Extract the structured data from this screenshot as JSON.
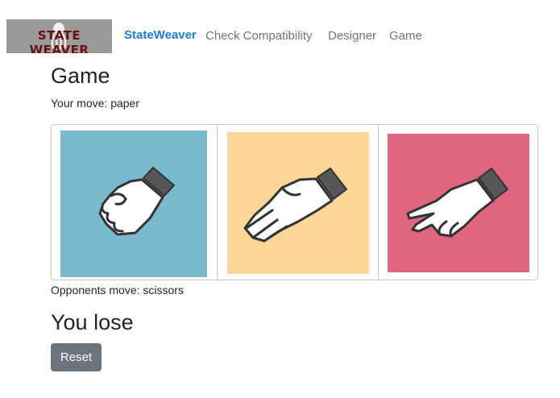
{
  "navbar": {
    "logo_text": "STATE WEAVER",
    "brand": "StateWeaver",
    "links": [
      "Check Compatibility",
      "Designer",
      "Game"
    ]
  },
  "game": {
    "title": "Game",
    "your_move": "Your move: paper",
    "choices": [
      {
        "move": "rock",
        "icon": "rock-hand-icon",
        "color": "#79bacf"
      },
      {
        "move": "paper",
        "icon": "paper-hand-icon",
        "color": "#fed698"
      },
      {
        "move": "scissors",
        "icon": "scissors-hand-icon",
        "color": "#e06680"
      }
    ],
    "opponent_move": "Opponents move: scissors",
    "result": "You lose",
    "reset_label": "Reset"
  }
}
